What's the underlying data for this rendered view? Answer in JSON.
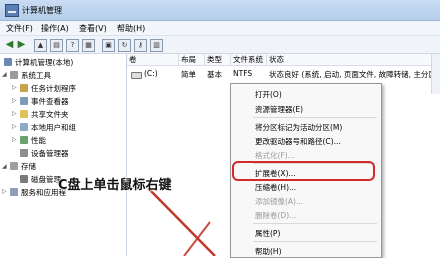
{
  "window": {
    "title": "计算机管理"
  },
  "menubar": [
    "文件(F)",
    "操作(A)",
    "查看(V)",
    "帮助(H)"
  ],
  "toolbar": [
    "back-icon",
    "forward-icon",
    "up-folder-icon",
    "show-hide-tree-icon",
    "help-icon",
    "properties-icon",
    "export-icon",
    "refresh-icon",
    "key-icon",
    "view-icon"
  ],
  "tree": {
    "root": "计算机管理(本地)",
    "items": [
      {
        "label": "系统工具",
        "level": 1
      },
      {
        "label": "任务计划程序",
        "level": 2
      },
      {
        "label": "事件查看器",
        "level": 2
      },
      {
        "label": "共享文件夹",
        "level": 2
      },
      {
        "label": "本地用户和组",
        "level": 2
      },
      {
        "label": "性能",
        "level": 2
      },
      {
        "label": "设备管理器",
        "level": 2
      },
      {
        "label": "存储",
        "level": 1
      },
      {
        "label": "磁盘管理",
        "level": 2
      },
      {
        "label": "服务和应用程",
        "level": 1
      }
    ]
  },
  "table": {
    "headers": [
      "卷",
      "布局",
      "类型",
      "文件系统",
      "状态"
    ],
    "rows": [
      [
        "(C:)",
        "简单",
        "基本",
        "NTFS",
        "状态良好 (系统, 启动, 页面文件, 故障转储, 主分区"
      ]
    ]
  },
  "context_menu": {
    "items": [
      {
        "label": "打开(O)",
        "enabled": true
      },
      {
        "label": "资源管理器(E)",
        "enabled": true
      },
      {
        "label": "将分区标记为活动分区(M)",
        "enabled": true
      },
      {
        "label": "更改驱动器号和路径(C)...",
        "enabled": true
      },
      {
        "label": "格式化(F)...",
        "enabled": false
      },
      {
        "label": "扩展卷(X)...",
        "enabled": true
      },
      {
        "label": "压缩卷(H)...",
        "enabled": true
      },
      {
        "label": "添加镜像(A)...",
        "enabled": false
      },
      {
        "label": "删除卷(D)...",
        "enabled": false
      },
      {
        "label": "属性(P)",
        "enabled": true
      },
      {
        "label": "帮助(H)",
        "enabled": true
      }
    ]
  },
  "annotation": {
    "text": "C盘上单击鼠标右键"
  },
  "colors": {
    "highlight": "#d42a2a",
    "titlebar": "#c9dcf3"
  }
}
